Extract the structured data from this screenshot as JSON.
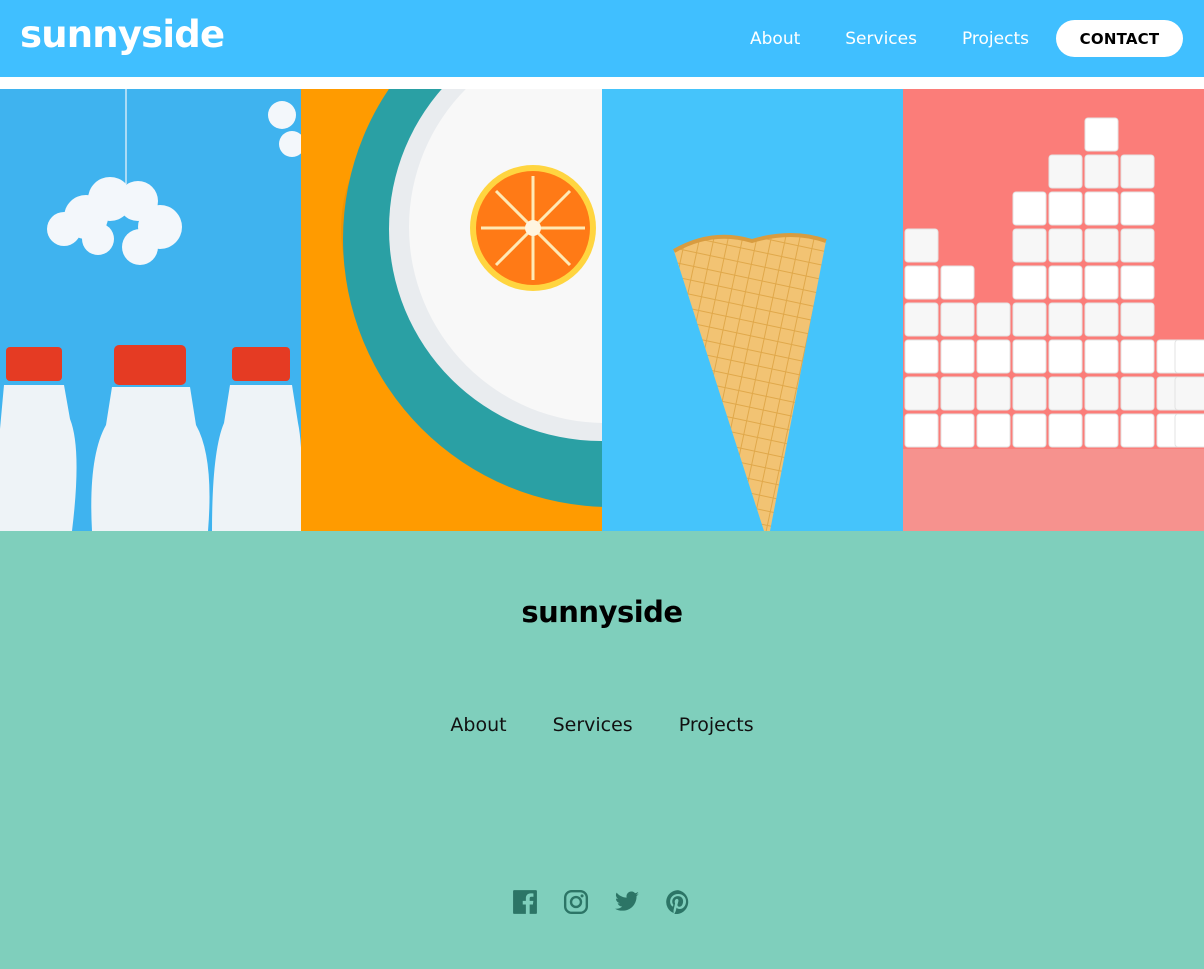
{
  "header": {
    "brand": "sunnyside",
    "nav": [
      "About",
      "Services",
      "Projects"
    ],
    "contact_label": "CONTACT"
  },
  "gallery": {
    "panels": [
      "milk-bottles-image",
      "orange-plate-image",
      "ice-cream-cone-image",
      "sugar-cubes-image"
    ]
  },
  "footer": {
    "brand": "sunnyside",
    "nav": [
      "About",
      "Services",
      "Projects"
    ],
    "social": [
      "facebook-icon",
      "instagram-icon",
      "twitter-icon",
      "pinterest-icon"
    ]
  },
  "colors": {
    "header_bg": "#40bfff",
    "footer_bg": "#7fcfbc",
    "social_icon": "#2c7566"
  }
}
